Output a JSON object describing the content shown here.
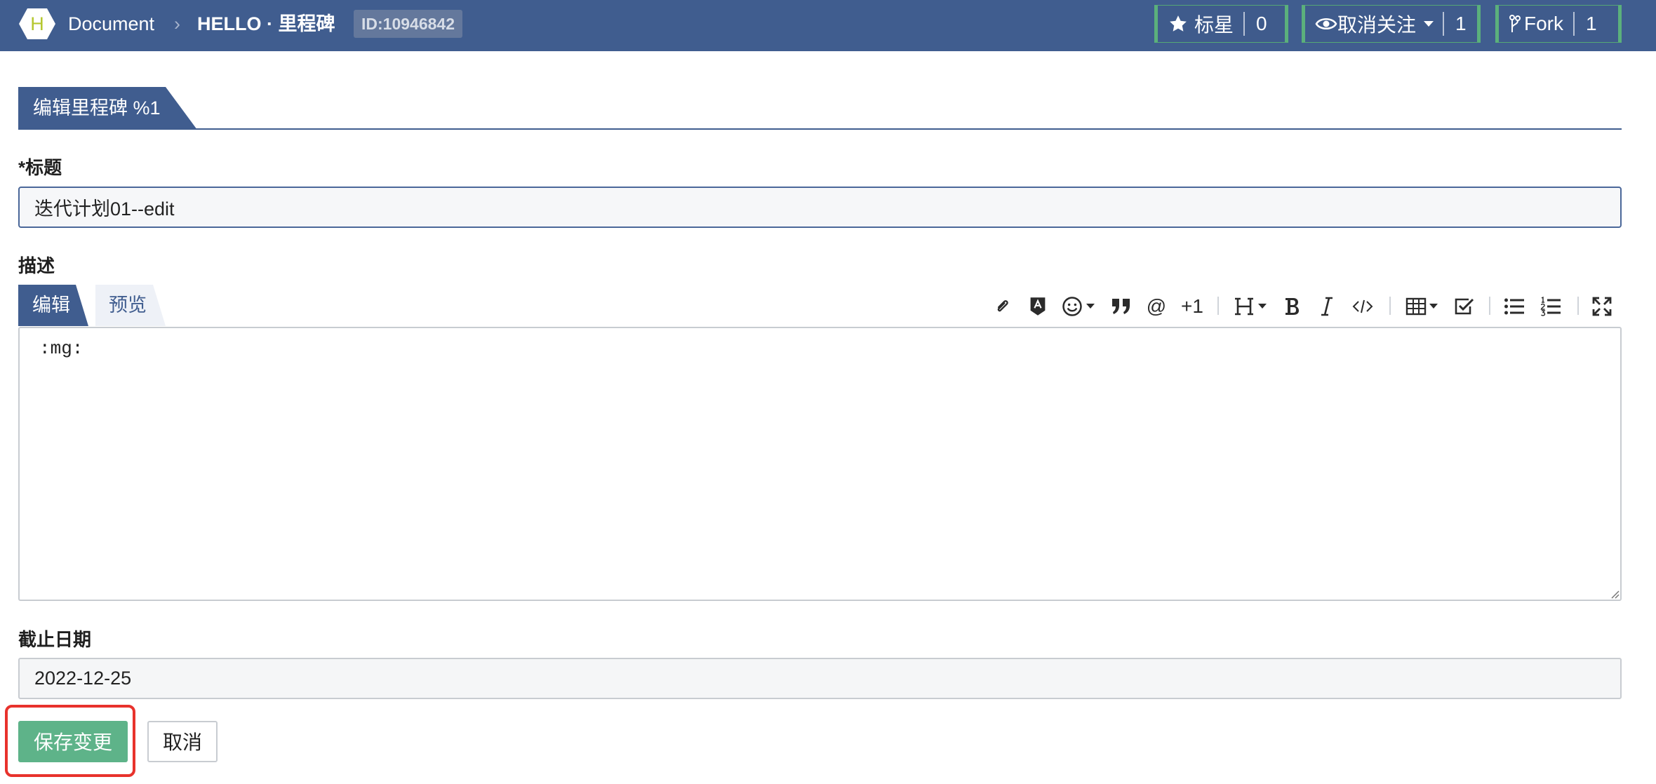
{
  "header": {
    "logo_letter": "H",
    "owner": "Document",
    "separator": "›",
    "repo": "HELLO · 里程碑",
    "repo_id": "ID:10946842",
    "star": {
      "label": "标星",
      "count": "0"
    },
    "watch": {
      "label": "取消关注",
      "count": "1"
    },
    "fork": {
      "label": "Fork",
      "count": "1"
    }
  },
  "section": {
    "title": "编辑里程碑 %1"
  },
  "form": {
    "title_label": "*标题",
    "title_value": "迭代计划01--edit",
    "description_label": "描述",
    "tabs": {
      "edit": "编辑",
      "preview": "预览"
    },
    "toolbar": {
      "items": [
        "paperclip-icon",
        "attachment-badge-icon",
        "emoji-icon",
        "quote-icon",
        "mention-icon",
        "plus-one",
        "heading-icon",
        "bold-icon",
        "italic-icon",
        "code-icon",
        "table-icon",
        "checkbox-icon",
        "bullet-list-icon",
        "numbered-list-icon",
        "fullscreen-icon"
      ],
      "mention": "@",
      "plus_one": "+1"
    },
    "description_value": ":mg:",
    "due_date_label": "截止日期",
    "due_date_value": "2022-12-25",
    "save_label": "保存变更",
    "cancel_label": "取消"
  },
  "colors": {
    "header_bg": "#405d8f",
    "accent_green": "#5eb389",
    "highlight_red": "#e8322c"
  }
}
